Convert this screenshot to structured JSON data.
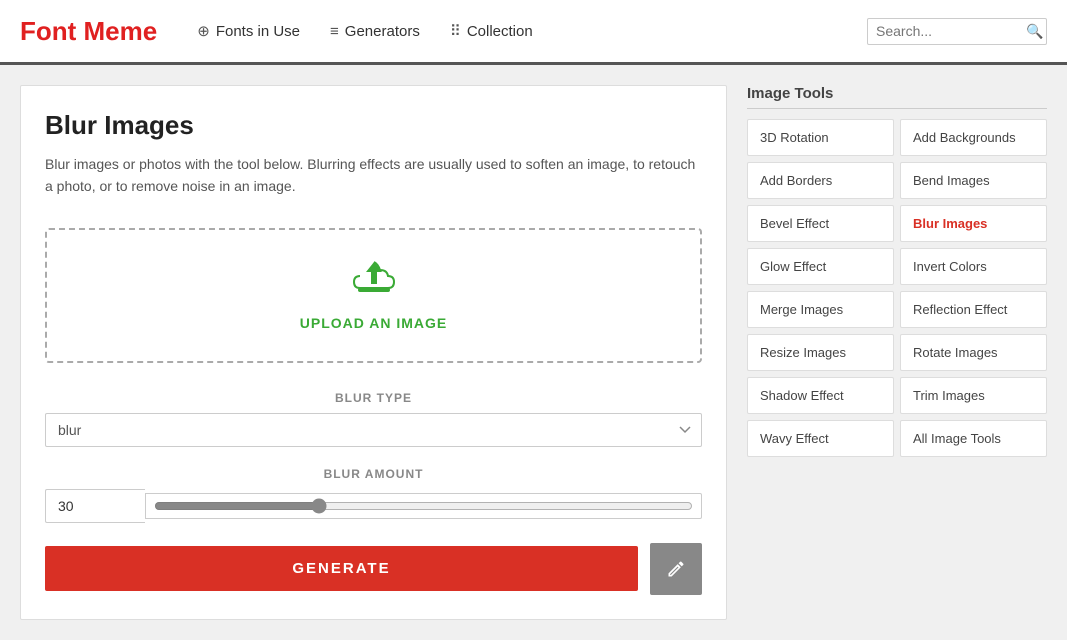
{
  "header": {
    "logo": "Font Meme",
    "nav": [
      {
        "id": "fonts-in-use",
        "label": "Fonts in Use",
        "icon": "⊕"
      },
      {
        "id": "generators",
        "label": "Generators",
        "icon": "≡"
      },
      {
        "id": "collection",
        "label": "Collection",
        "icon": "⠿"
      }
    ],
    "search": {
      "placeholder": "Search..."
    }
  },
  "page": {
    "title": "Blur Images",
    "description": "Blur images or photos with the tool below. Blurring effects are usually used to soften an image, to retouch a photo, or to remove noise in an image.",
    "upload_label": "UPLOAD AN IMAGE",
    "blur_type_label": "BLUR TYPE",
    "blur_type_value": "blur",
    "blur_amount_label": "BLUR AMOUNT",
    "blur_amount_value": "30",
    "generate_label": "GENERATE"
  },
  "image_tools": {
    "header": "Image Tools",
    "items": [
      {
        "id": "3d-rotation",
        "label": "3D Rotation",
        "col": 1
      },
      {
        "id": "add-backgrounds",
        "label": "Add Backgrounds",
        "col": 2
      },
      {
        "id": "add-borders",
        "label": "Add Borders",
        "col": 1
      },
      {
        "id": "bend-images",
        "label": "Bend Images",
        "col": 2
      },
      {
        "id": "bevel-effect",
        "label": "Bevel Effect",
        "col": 1
      },
      {
        "id": "blur-images",
        "label": "Blur Images",
        "col": 2,
        "active": true
      },
      {
        "id": "glow-effect",
        "label": "Glow Effect",
        "col": 1
      },
      {
        "id": "invert-colors",
        "label": "Invert Colors",
        "col": 2
      },
      {
        "id": "merge-images",
        "label": "Merge Images",
        "col": 1
      },
      {
        "id": "reflection-effect",
        "label": "Reflection Effect",
        "col": 2
      },
      {
        "id": "resize-images",
        "label": "Resize Images",
        "col": 1
      },
      {
        "id": "rotate-images",
        "label": "Rotate Images",
        "col": 2
      },
      {
        "id": "shadow-effect",
        "label": "Shadow Effect",
        "col": 1
      },
      {
        "id": "trim-images",
        "label": "Trim Images",
        "col": 2
      },
      {
        "id": "wavy-effect",
        "label": "Wavy Effect",
        "col": 1
      },
      {
        "id": "all-image-tools",
        "label": "All Image Tools",
        "col": 2
      }
    ]
  }
}
